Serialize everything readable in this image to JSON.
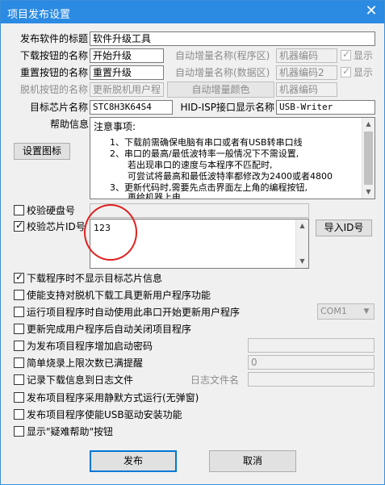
{
  "window": {
    "title": "项目发布设置",
    "close_glyph": "✕"
  },
  "fields": {
    "title_label": "发布软件的标题",
    "title_value": "软件升级工具",
    "download_label": "下载按钮的名称",
    "download_value": "开始升级",
    "reset_label": "重置按钮的名称",
    "reset_value": "重置升级",
    "offline_label": "脱机按钮的名称",
    "offline_value": "更新脱机用户程",
    "auto_prog_label": "自动增量名称(程序区)",
    "auto_prog_value": "机器编码",
    "auto_data_label": "自动增量名称(数据区)",
    "auto_data_value": "机器编码2",
    "auto_color_button": "自动增量颜色",
    "auto_third_value": "机器编码",
    "show_label": "显示",
    "chip_label": "目标芯片名称",
    "chip_value": "STC8H3K64S4",
    "hid_label": "HID-ISP接口显示名称",
    "hid_value": "USB-Writer",
    "help_label": "帮助信息",
    "set_icon_button": "设置图标"
  },
  "help_text": {
    "lines": [
      "注意事项:",
      "1、下载前需确保电脑有串口或者有USB转串口线",
      "2、串口的最高/最低波特率一般情况下不需设置,",
      "若出现串口的速度与本程序不匹配时,",
      "可尝试将最高和最低波特率都修改为2400或者4800",
      "3、更新代码时,需要先点击界面左上角的编程按钮,",
      "再给机器上电"
    ]
  },
  "verify": {
    "disk_label": "校验硬盘号",
    "chip_id_label": "校验芯片ID号",
    "chip_id_value": "123",
    "import_button": "导入ID号"
  },
  "options": [
    {
      "label": "下载程序时不显示目标芯片信息",
      "checked": true
    },
    {
      "label": "使能支持对脱机下载工具更新用户程序功能",
      "checked": false
    },
    {
      "label": "运行项目程序时自动使用此串口开始更新用户程序",
      "checked": false
    },
    {
      "label": "更新完成用户程序后自动关闭项目程序",
      "checked": false
    },
    {
      "label": "为发布项目程序增加启动密码",
      "checked": false
    },
    {
      "label": "简单烧录上限次数已满提醒",
      "checked": false
    },
    {
      "label": "记录下载信息到日志文件",
      "checked": false
    },
    {
      "label": "发布项目程序采用静默方式运行(无弹窗)",
      "checked": false
    },
    {
      "label": "发布项目程序使能USB驱动安装功能",
      "checked": false
    },
    {
      "label": "显示\"疑难帮助\"按钮",
      "checked": false
    }
  ],
  "extras": {
    "com_port": "COM1",
    "limit_count": "0",
    "log_file_label": "日志文件名"
  },
  "buttons": {
    "publish": "发布",
    "cancel": "取消"
  },
  "glyphs": {
    "check": "✓",
    "up": "▲",
    "down": "▼"
  }
}
